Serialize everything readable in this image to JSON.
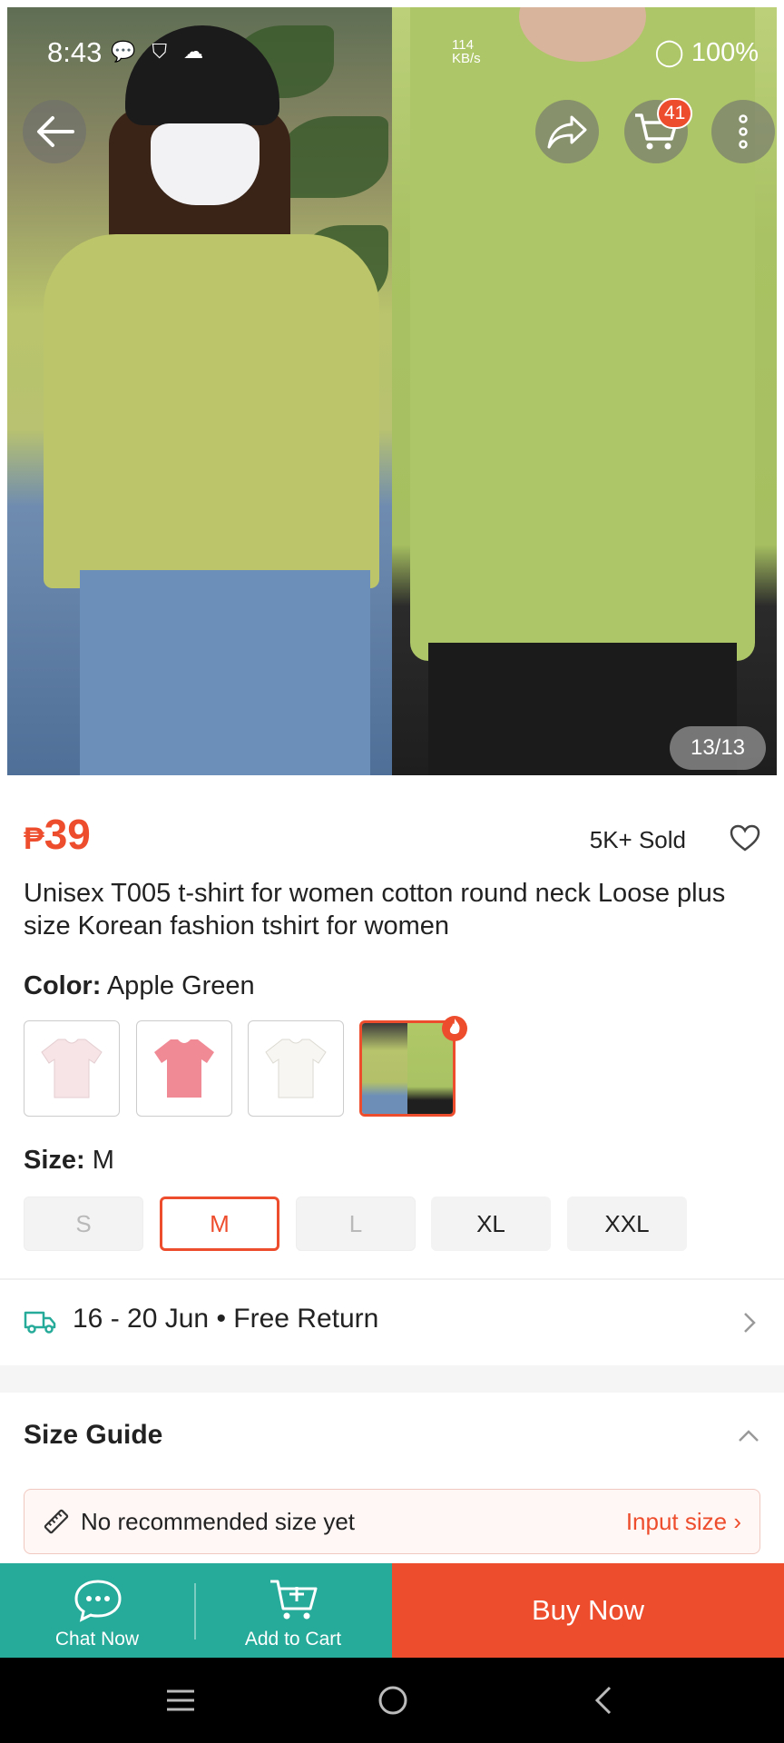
{
  "status_bar": {
    "time": "8:43",
    "network_speed_value": "114",
    "network_speed_unit": "KB/s",
    "battery": "100%"
  },
  "hero": {
    "image_counter": "13/13",
    "cart_count": "41"
  },
  "product": {
    "price_currency": "₱",
    "price": "39",
    "sold": "5K+ Sold",
    "title": "Unisex T005 t-shirt for women cotton round neck Loose plus size Korean fashion tshirt for women"
  },
  "color": {
    "label": "Color:",
    "value": "Apple Green",
    "options": [
      {
        "name": "Light Pink",
        "color": "#f6e4e6"
      },
      {
        "name": "Pink",
        "color": "#f08a95"
      },
      {
        "name": "White",
        "color": "#f7f6f2"
      },
      {
        "name": "Apple Green",
        "color": "#b3c768"
      }
    ]
  },
  "size": {
    "label": "Size:",
    "value": "M",
    "options": [
      {
        "label": "S",
        "state": "disabled"
      },
      {
        "label": "M",
        "state": "selected"
      },
      {
        "label": "L",
        "state": "disabled"
      },
      {
        "label": "XL",
        "state": "available"
      },
      {
        "label": "XXL",
        "state": "available"
      }
    ]
  },
  "delivery": {
    "text": "16 - 20 Jun • Free Return"
  },
  "size_guide": {
    "title": "Size Guide",
    "recommend_text": "No recommended size yet",
    "input_label": "Input size"
  },
  "bottom_bar": {
    "chat_label": "Chat Now",
    "cart_label": "Add to Cart",
    "buy_label": "Buy Now"
  },
  "colors": {
    "accent": "#ee4d2d",
    "teal": "#26aa99"
  }
}
